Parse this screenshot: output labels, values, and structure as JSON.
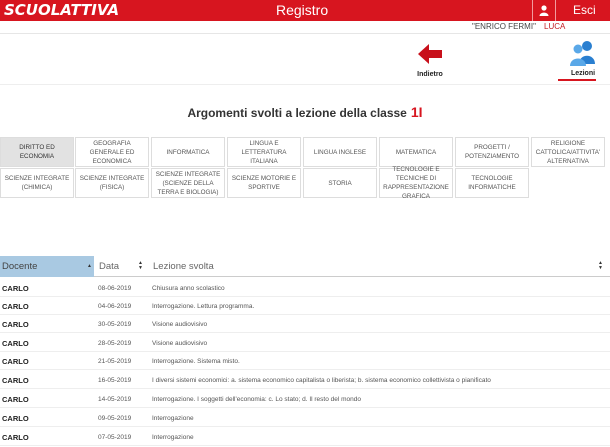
{
  "header": {
    "logo": "SCUOLATTIVA",
    "title": "Registro",
    "logout_label": "Esci",
    "school": "\"ENRICO FERMI\"",
    "user": "LUCA"
  },
  "nav": {
    "back_label": "Indietro",
    "lessons_label": "Lezioni"
  },
  "page": {
    "heading": "Argomenti svolti a lezione della classe",
    "class_name": "1I"
  },
  "subjects": [
    "DIRITTO ED ECONOMIA",
    "GEOGRAFIA GENERALE ED ECONOMICA",
    "INFORMATICA",
    "LINGUA E LETTERATURA ITALIANA",
    "LINGUA INGLESE",
    "MATEMATICA",
    "PROGETTI / POTENZIAMENTO",
    "RELIGIONE CATTOLICA/ATTIVITA' ALTERNATIVA",
    "SCIENZE INTEGRATE (CHIMICA)",
    "SCIENZE INTEGRATE (FISICA)",
    "SCIENZE INTEGRATE (SCIENZE DELLA TERRA E BIOLOGIA)",
    "SCIENZE MOTORIE E SPORTIVE",
    "STORIA",
    "TECNOLOGIE E TECNICHE DI RAPPRESENTAZIONE GRAFICA",
    "TECNOLOGIE INFORMATICHE"
  ],
  "table": {
    "headers": {
      "docente": "Docente",
      "data": "Data",
      "lezione": "Lezione svolta"
    },
    "rows": [
      {
        "docente": "CARLO",
        "data": "08-06-2019",
        "lezione": "Chiusura anno scolastico"
      },
      {
        "docente": "CARLO",
        "data": "04-06-2019",
        "lezione": "Interrogazione. Lettura programma."
      },
      {
        "docente": "CARLO",
        "data": "30-05-2019",
        "lezione": "Visione audiovisivo"
      },
      {
        "docente": "CARLO",
        "data": "28-05-2019",
        "lezione": "Visione audiovisivo"
      },
      {
        "docente": "CARLO",
        "data": "21-05-2019",
        "lezione": "Interrogazione. Sistema misto."
      },
      {
        "docente": "CARLO",
        "data": "16-05-2019",
        "lezione": "I diversi sistemi economici: a. sistema economico capitalista o liberista; b. sistema economico collettivista o pianificato"
      },
      {
        "docente": "CARLO",
        "data": "14-05-2019",
        "lezione": "Interrogazione. I soggetti dell'economia: c. Lo stato; d. Il resto del mondo"
      },
      {
        "docente": "CARLO",
        "data": "09-05-2019",
        "lezione": "Interrogazione"
      },
      {
        "docente": "CARLO",
        "data": "07-05-2019",
        "lezione": "Interrogazione"
      }
    ]
  },
  "colors": {
    "brand_red": "#d7151f",
    "active_sort_header": "#a9c9e2",
    "active_subject": "#e2e2e2"
  }
}
